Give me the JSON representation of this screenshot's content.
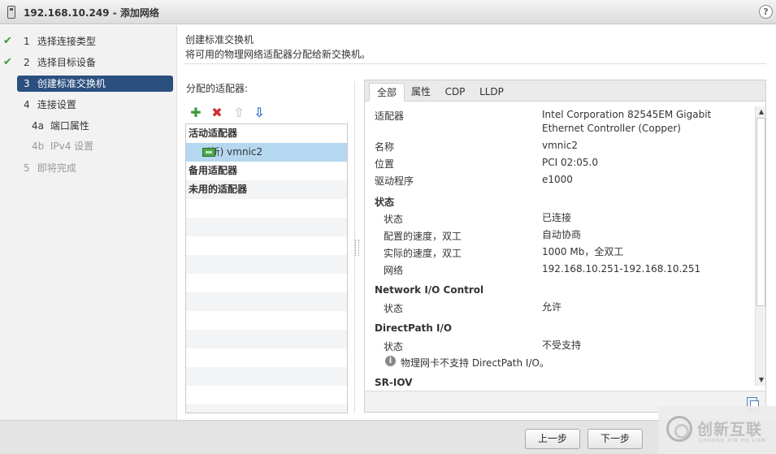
{
  "window": {
    "title": "192.168.10.249 - 添加网络",
    "help_label": "?"
  },
  "steps": [
    {
      "num": "1",
      "label": "选择连接类型"
    },
    {
      "num": "2",
      "label": "选择目标设备"
    },
    {
      "num": "3",
      "label": "创建标准交换机"
    },
    {
      "num": "4",
      "label": "连接设置"
    },
    {
      "num": "4a",
      "label": "端口属性"
    },
    {
      "num": "4b",
      "label": "IPv4 设置"
    },
    {
      "num": "5",
      "label": "即将完成"
    }
  ],
  "header": {
    "title": "创建标准交换机",
    "description": "将可用的物理网络适配器分配给新交换机。"
  },
  "adapters": {
    "label": "分配的适配器:",
    "toolbar": {
      "add": "✚",
      "remove": "✖",
      "move_up": "⇧",
      "move_down": "⇩"
    },
    "groups": {
      "active": "活动适配器",
      "standby": "备用适配器",
      "unused": "未用的适配器"
    },
    "selected_adapter": "(新) vmnic2"
  },
  "details": {
    "tabs": [
      "全部",
      "属性",
      "CDP",
      "LLDP"
    ],
    "active_tab": "全部",
    "general": {
      "adapter_key": "适配器",
      "adapter_value": "Intel Corporation 82545EM Gigabit Ethernet Controller (Copper)",
      "name_key": "名称",
      "name_value": "vmnic2",
      "location_key": "位置",
      "location_value": "PCI 02:05.0",
      "driver_key": "驱动程序",
      "driver_value": "e1000"
    },
    "status_section": {
      "title": "状态",
      "state_key": "状态",
      "state_value": "已连接",
      "configured_speed_key": "配置的速度，双工",
      "configured_speed_value": "自动协商",
      "actual_speed_key": "实际的速度，双工",
      "actual_speed_value": "1000 Mb，全双工",
      "network_key": "网络",
      "network_value": "192.168.10.251-192.168.10.251"
    },
    "nioc_section": {
      "title": "Network I/O Control",
      "state_key": "状态",
      "state_value": "允许"
    },
    "directpath_section": {
      "title": "DirectPath I/O",
      "state_key": "状态",
      "state_value": "不受支持",
      "info": "物理网卡不支持 DirectPath I/O。"
    },
    "sriov_section": {
      "title": "SR-IOV"
    }
  },
  "footer": {
    "back_label": "上一步",
    "next_label": "下一步"
  },
  "watermark": {
    "text": "创新互联",
    "sub": "CHUANG XIN HU LIAN"
  },
  "colors": {
    "active_step": "#2b4f7f",
    "selected_row": "#b6d7f0",
    "add_icon": "#3a9a3a",
    "remove_icon": "#d03030",
    "down_icon": "#2f74c9"
  }
}
